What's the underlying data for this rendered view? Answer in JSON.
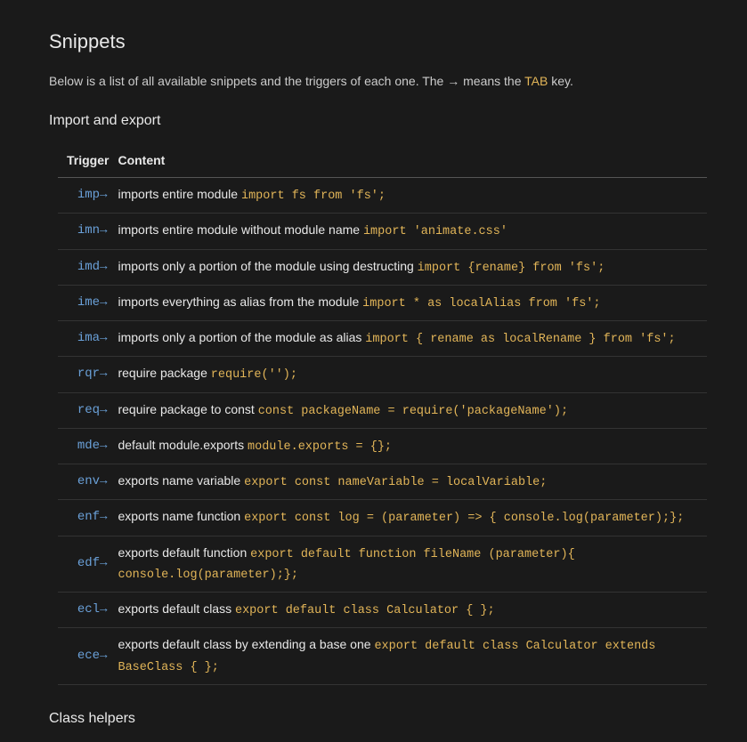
{
  "title": "Snippets",
  "intro_pre": "Below is a list of all available snippets and the triggers of each one. The ",
  "intro_glyph": "→",
  "intro_mid": " means the ",
  "intro_tab": "TAB",
  "intro_post": " key.",
  "headers": {
    "trigger": "Trigger",
    "content": "Content"
  },
  "section1": {
    "title": "Import and export",
    "rows": [
      {
        "trigger": "imp",
        "desc": "imports entire module ",
        "code": "import fs from 'fs';"
      },
      {
        "trigger": "imn",
        "desc": "imports entire module without module name ",
        "code": "import 'animate.css'"
      },
      {
        "trigger": "imd",
        "desc": "imports only a portion of the module using destructing ",
        "code": "import {rename} from 'fs';"
      },
      {
        "trigger": "ime",
        "desc": "imports everything as alias from the module ",
        "code": "import * as localAlias from 'fs';"
      },
      {
        "trigger": "ima",
        "desc": "imports only a portion of the module as alias ",
        "code": "import { rename as localRename } from 'fs';"
      },
      {
        "trigger": "rqr",
        "desc": "require package ",
        "code": "require('');"
      },
      {
        "trigger": "req",
        "desc": "require package to const ",
        "code": "const packageName = require('packageName');"
      },
      {
        "trigger": "mde",
        "desc": "default module.exports ",
        "code": "module.exports = {};"
      },
      {
        "trigger": "env",
        "desc": "exports name variable ",
        "code": "export const nameVariable = localVariable;"
      },
      {
        "trigger": "enf",
        "desc": "exports name function ",
        "code": "export const log = (parameter) => { console.log(parameter);};"
      },
      {
        "trigger": "edf",
        "desc": "exports default function ",
        "code": "export default function fileName (parameter){ console.log(parameter);};"
      },
      {
        "trigger": "ecl",
        "desc": "exports default class ",
        "code": "export default class Calculator { };"
      },
      {
        "trigger": "ece",
        "desc": "exports default class by extending a base one ",
        "code": "export default class Calculator extends BaseClass { };"
      }
    ]
  },
  "section2": {
    "title": "Class helpers"
  },
  "tab_glyph": "→"
}
